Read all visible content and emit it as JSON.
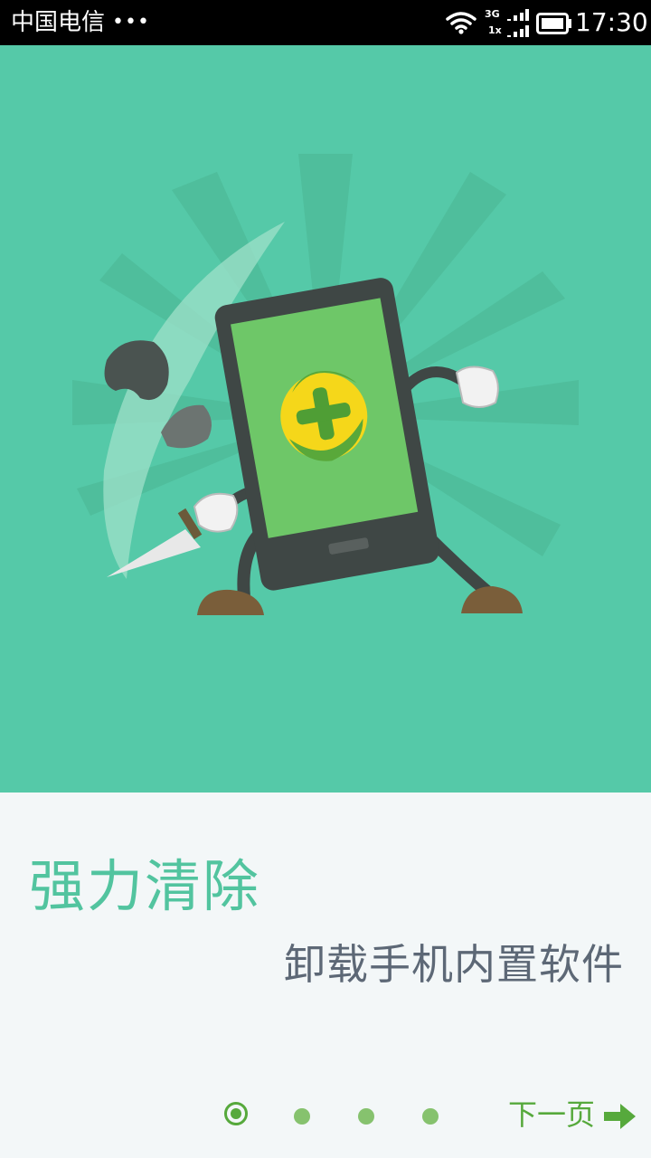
{
  "status_bar": {
    "carrier": "中国电信",
    "carrier_dots": "•••",
    "network_top": "3G",
    "network_bottom": "1x",
    "time": "17:30"
  },
  "hero": {
    "background_color": "#55c9a8",
    "illustration": "phone-cleaner-mascot"
  },
  "content": {
    "headline": "强力清除",
    "subline": "卸载手机内置软件"
  },
  "pager": {
    "count": 4,
    "active_index": 0,
    "active_color": "#56a93c",
    "inactive_color": "#86c26e"
  },
  "next": {
    "label": "下一页",
    "icon": "arrow-right-icon"
  }
}
